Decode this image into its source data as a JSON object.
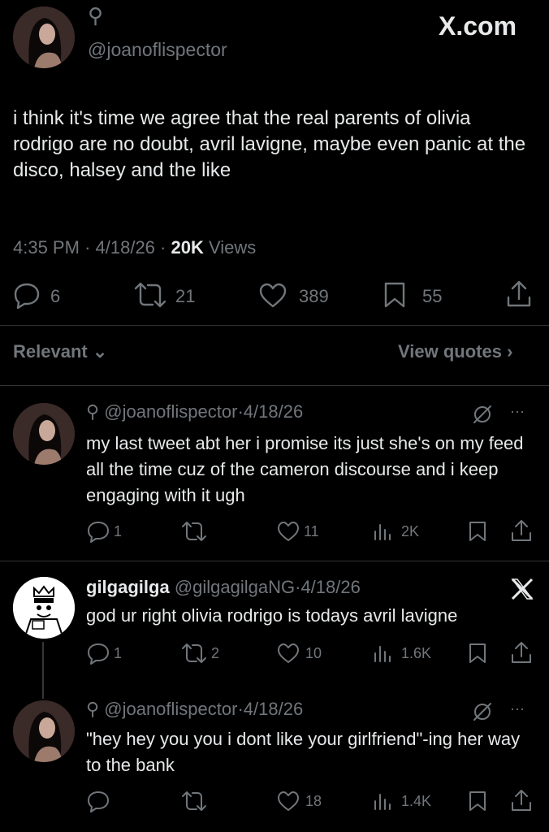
{
  "brand": {
    "logo_text": "X.com"
  },
  "main_tweet": {
    "symbol": "⚲",
    "handle": "@joanoflispector",
    "text": "i think it's time we agree that the real parents of olivia rodrigo are no doubt, avril lavigne, maybe even panic at the disco, halsey and the like",
    "time": "4:35 PM",
    "date": "4/18/26",
    "views_count": "20K",
    "views_label": "Views",
    "separator": "·",
    "replies": "6",
    "reposts": "21",
    "likes": "389",
    "bookmarks": "55"
  },
  "filter": {
    "relevant": "Relevant",
    "relevant_chevron": "⌄",
    "view_quotes": "View quotes",
    "view_quotes_chevron": "›"
  },
  "replies": [
    {
      "symbol": "⚲",
      "handle": "@joanoflispector",
      "sep": "·",
      "date": "4/18/26",
      "more": "···",
      "text": "my last tweet abt her i promise its just she's on my feed all the time cuz of the cameron discourse and i keep engaging with it ugh",
      "replies": "1",
      "reposts": "",
      "likes": "11",
      "views": "2K"
    },
    {
      "name": "gilgagilga",
      "handle": "@gilgagilgaNG",
      "sep": "·",
      "date": "4/18/26",
      "text": "god ur right olivia rodrigo is todays avril lavigne",
      "replies": "1",
      "reposts": "2",
      "likes": "10",
      "views": "1.6K"
    },
    {
      "symbol": "⚲",
      "handle": "@joanoflispector",
      "sep": "·",
      "date": "4/18/26",
      "more": "···",
      "text": "\"hey hey you you i dont like your girlfriend\"-ing her way to the bank",
      "replies": "",
      "reposts": "",
      "likes": "18",
      "views": "1.4K"
    }
  ]
}
